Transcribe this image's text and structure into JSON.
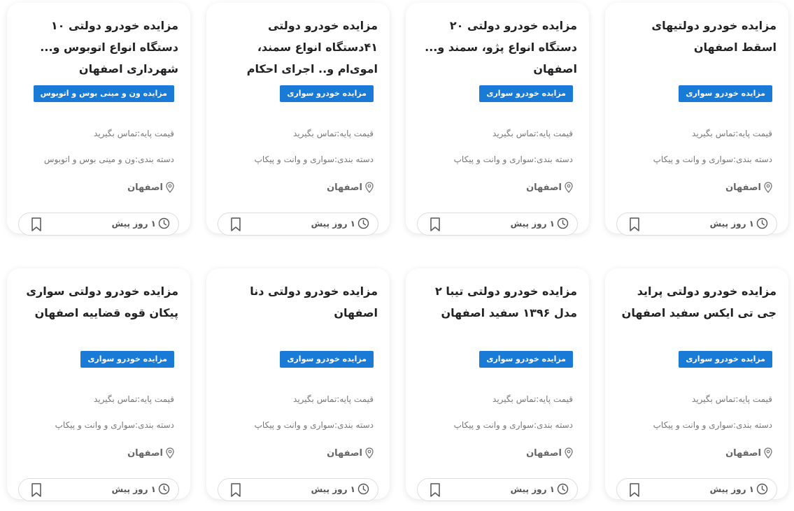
{
  "listings": [
    {
      "title": "مزایده خودرو دولتیهای اسقط اصفهان",
      "category_badge": "مزایده خودرو سواری",
      "price": "قیمت پایه:تماس بگیرید",
      "category": "دسته بندی:سواری و وانت و پیکاپ",
      "location": "اصفهان",
      "time": "۱ روز پیش",
      "icons": {
        "location": "map-pin-icon",
        "time": "clock-icon",
        "bookmark": "bookmark-icon"
      }
    },
    {
      "title": "مزایده خودرو دولتی ۲۰ دستگاه انواع پژو، سمند و... اصفهان",
      "category_badge": "مزایده خودرو سواری",
      "price": "قیمت پایه:تماس بگیرید",
      "category": "دسته بندی:سواری و وانت و پیکاپ",
      "location": "اصفهان",
      "time": "۱ روز پیش",
      "icons": {
        "location": "map-pin-icon",
        "time": "clock-icon",
        "bookmark": "bookmark-icon"
      }
    },
    {
      "title": "مزایده خودرو دولتی ۴۱دستگاه انواع سمند، اموی‌ام و.. اجرای احکام",
      "category_badge": "مزایده خودرو سواری",
      "price": "قیمت پایه:تماس بگیرید",
      "category": "دسته بندی:سواری و وانت و پیکاپ",
      "location": "اصفهان",
      "time": "۱ روز پیش",
      "icons": {
        "location": "map-pin-icon",
        "time": "clock-icon",
        "bookmark": "bookmark-icon"
      }
    },
    {
      "title": "مزایده خودرو دولتی ۱۰ دستگاه انواع اتوبوس و... شهرداری اصفهان",
      "category_badge": "مزایده ون و مینی بوس و اتوبوس",
      "price": "قیمت پایه:تماس بگیرید",
      "category": "دسته بندی:ون و مینی بوس و اتوبوس",
      "location": "اصفهان",
      "time": "۱ روز پیش",
      "icons": {
        "location": "map-pin-icon",
        "time": "clock-icon",
        "bookmark": "bookmark-icon"
      }
    },
    {
      "title": "مزایده خودرو دولتی پراید جی تی ایکس سفید اصفهان",
      "category_badge": "مزایده خودرو سواری",
      "price": "قیمت پایه:تماس بگیرید",
      "category": "دسته بندی:سواری و وانت و پیکاپ",
      "location": "اصفهان",
      "time": "۱ روز پیش",
      "icons": {
        "location": "map-pin-icon",
        "time": "clock-icon",
        "bookmark": "bookmark-icon"
      }
    },
    {
      "title": "مزایده خودرو دولتی تیبا ۲ مدل ۱۳۹۶ سفید اصفهان",
      "category_badge": "مزایده خودرو سواری",
      "price": "قیمت پایه:تماس بگیرید",
      "category": "دسته بندی:سواری و وانت و پیکاپ",
      "location": "اصفهان",
      "time": "۱ روز پیش",
      "icons": {
        "location": "map-pin-icon",
        "time": "clock-icon",
        "bookmark": "bookmark-icon"
      }
    },
    {
      "title": "مزایده خودرو دولتی دنا اصفهان",
      "category_badge": "مزایده خودرو سواری",
      "price": "قیمت پایه:تماس بگیرید",
      "category": "دسته بندی:سواری و وانت و پیکاپ",
      "location": "اصفهان",
      "time": "۱ روز پیش",
      "icons": {
        "location": "map-pin-icon",
        "time": "clock-icon",
        "bookmark": "bookmark-icon"
      }
    },
    {
      "title": "مزایده خودرو دولتی سواری پیکان قوه قضاییه اصفهان",
      "category_badge": "مزایده خودرو سواری",
      "price": "قیمت پایه:تماس بگیرید",
      "category": "دسته بندی:سواری و وانت و پیکاپ",
      "location": "اصفهان",
      "time": "۱ روز پیش",
      "icons": {
        "location": "map-pin-icon",
        "time": "clock-icon",
        "bookmark": "bookmark-icon"
      }
    }
  ],
  "colors": {
    "badge_background": "#1a7bd6",
    "badge_text": "#ffffff",
    "title_text": "#222222",
    "meta_text": "#777777"
  }
}
